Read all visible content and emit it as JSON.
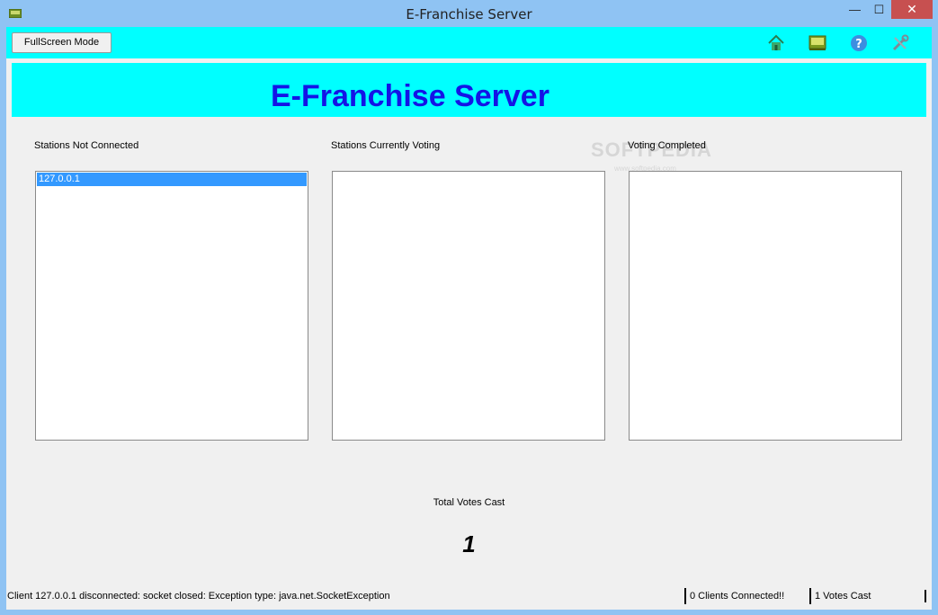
{
  "window": {
    "title": "E-Franchise Server",
    "controls": {
      "minimize": "—",
      "maximize": "☐",
      "close": "✕"
    }
  },
  "toolbar": {
    "fullscreen_label": "FullScreen Mode",
    "icons": [
      "home-icon",
      "monitor-icon",
      "help-icon",
      "settings-tools-icon"
    ]
  },
  "banner": {
    "title": "E-Franchise Server"
  },
  "lists": {
    "not_connected": {
      "label": "Stations Not Connected",
      "items": [
        "127.0.0.1"
      ]
    },
    "currently_voting": {
      "label": "Stations Currently Voting",
      "items": []
    },
    "completed": {
      "label": "Voting Completed",
      "items": []
    }
  },
  "watermark": {
    "text": "SOFTPEDIA",
    "sub": "www.softpedia.com"
  },
  "votes": {
    "label": "Total Votes Cast",
    "count": "1"
  },
  "status": {
    "message": "Client 127.0.0.1 disconnected: socket closed: Exception type:  java.net.SocketException",
    "clients": "0 Clients Connected!!",
    "votes": "1 Votes Cast"
  },
  "colors": {
    "accent": "#00ffff",
    "title_blue": "#1414e6",
    "selection": "#3399ff",
    "titlebar": "#8fc3f3",
    "close": "#c75050"
  }
}
